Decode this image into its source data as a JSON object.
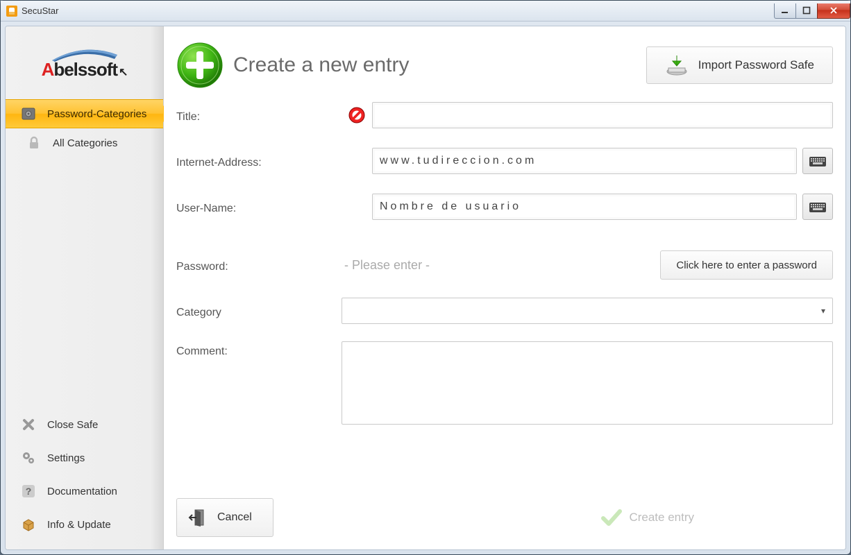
{
  "window": {
    "title": "SecuStar"
  },
  "logo": {
    "brand_first": "A",
    "brand_rest": "belssoft"
  },
  "sidebar": {
    "nav": [
      {
        "label": "Password-Categories",
        "active": true
      },
      {
        "label": "All Categories",
        "active": false
      }
    ],
    "bottom": [
      {
        "label": "Close Safe",
        "icon": "x"
      },
      {
        "label": "Settings",
        "icon": "gears"
      },
      {
        "label": "Documentation",
        "icon": "question"
      },
      {
        "label": "Info & Update",
        "icon": "package"
      }
    ]
  },
  "header": {
    "title": "Create a new entry",
    "import_label": "Import Password Safe"
  },
  "form": {
    "title_label": "Title:",
    "title_value": "",
    "address_label": "Internet-Address:",
    "address_value": "www.tudireccion.com",
    "username_label": "User-Name:",
    "username_value": "Nombre de usuario",
    "password_label": "Password:",
    "password_placeholder": "- Please enter -",
    "password_button": "Click here to enter a password",
    "category_label": "Category",
    "category_value": "",
    "comment_label": "Comment:",
    "comment_value": ""
  },
  "footer": {
    "cancel_label": "Cancel",
    "create_label": "Create entry"
  }
}
